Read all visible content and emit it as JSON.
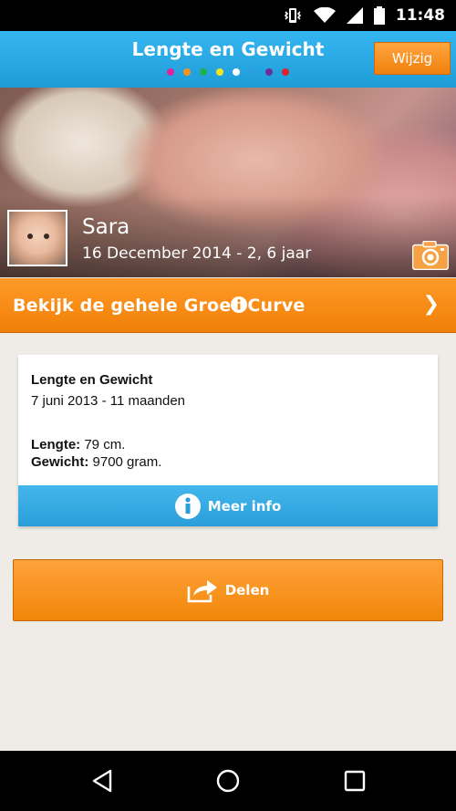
{
  "status_bar": {
    "time": "11:48",
    "icons": [
      "vibrate-icon",
      "wifi-icon",
      "signal-icon",
      "battery-icon"
    ]
  },
  "header": {
    "title": "Lengte en Gewicht",
    "edit_label": "Wijzig",
    "dot_colors": [
      "#e0219c",
      "#f7941d",
      "#1fb24a",
      "#f5e51a",
      "#ffffff",
      "#2b9fe0",
      "#6a2f9a",
      "#e0202a"
    ]
  },
  "profile": {
    "name": "Sara",
    "birth_info": "16 December 2014 - 2, 6 jaar"
  },
  "growth_curve": {
    "label_part1": "Bekijk de gehele Groe",
    "label_part2": "Curve"
  },
  "measurement": {
    "title": "Lengte en Gewicht",
    "date": "7 juni 2013 - 11 maanden",
    "length_label": "Lengte:",
    "length_value": " 79 cm.",
    "weight_label": "Gewicht:",
    "weight_value": " 9700 gram.",
    "more_info_label": "Meer info"
  },
  "share": {
    "label": "Delen"
  },
  "colors": {
    "header_blue": "#29a9e6",
    "orange": "#f7891a",
    "background": "#efebe7"
  }
}
